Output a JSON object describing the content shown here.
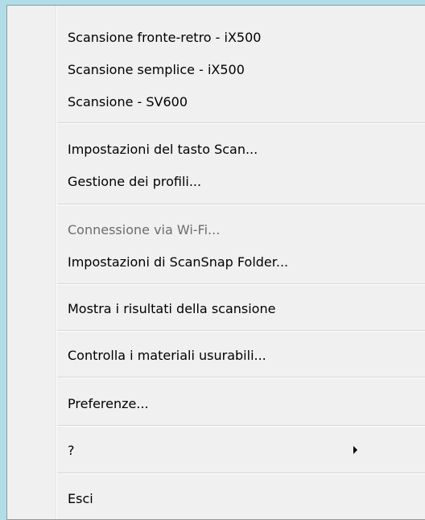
{
  "menu": {
    "items": [
      {
        "label": "Scansione fronte-retro - iX500"
      },
      {
        "label": "Scansione semplice - iX500"
      },
      {
        "label": "Scansione - SV600"
      },
      {
        "label": "Impostazioni del tasto Scan..."
      },
      {
        "label": "Gestione dei profili..."
      },
      {
        "label": "Connessione via Wi-Fi...",
        "disabled": true
      },
      {
        "label": "Impostazioni di ScanSnap Folder..."
      },
      {
        "label": "Mostra i risultati della scansione"
      },
      {
        "label": "Controlla i materiali usurabili..."
      },
      {
        "label": "Preferenze..."
      },
      {
        "label": "?",
        "submenu_icon": "chevron-right-icon"
      },
      {
        "label": "Esci"
      }
    ]
  },
  "colors": {
    "menu_background": "#f0f0f0",
    "desktop_background": "#b3dde6",
    "disabled_text": "#6d6d6d"
  }
}
